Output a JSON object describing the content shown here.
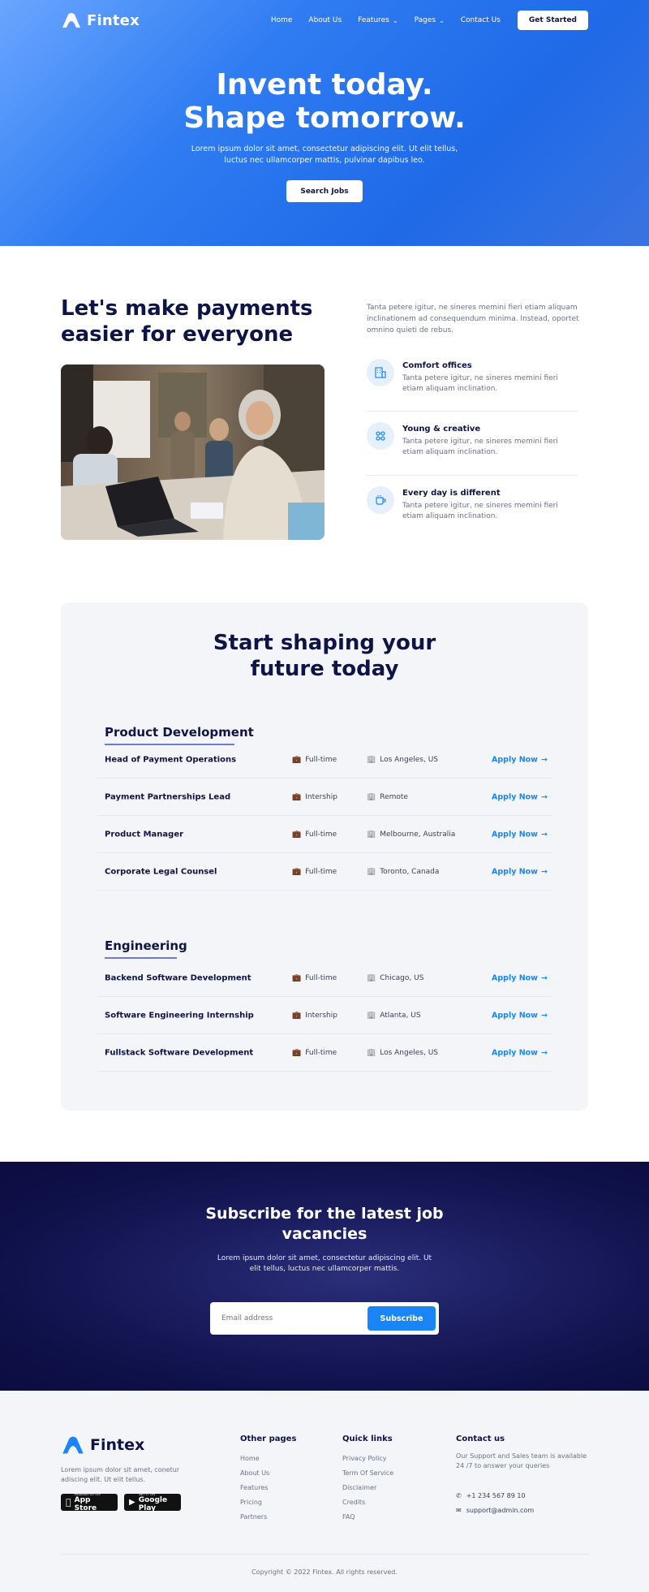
{
  "header": {
    "brand": "Fintex",
    "nav": [
      {
        "label": "Home",
        "has_dropdown": false
      },
      {
        "label": "About Us",
        "has_dropdown": false
      },
      {
        "label": "Features",
        "has_dropdown": true
      },
      {
        "label": "Pages",
        "has_dropdown": true
      },
      {
        "label": "Contact Us",
        "has_dropdown": false
      }
    ],
    "cta": "Get Started"
  },
  "hero": {
    "title_line1": "Invent today.",
    "title_line2": "Shape tomorrow.",
    "subtitle_line1": "Lorem ipsum dolor sit amet, consectetur adipiscing elit. Ut elit tellus,",
    "subtitle_line2": "luctus nec ullamcorper mattis, pulvinar dapibus leo.",
    "button": "Search Jobs"
  },
  "about": {
    "title_line1": "Let's make payments",
    "title_line2": "easier for everyone",
    "intro": "Tanta petere igitur, ne sineres memini fieri etiam aliquam inclinationem ad consequendum minima. Instead, oportet omnino quieti de rebus.",
    "features": [
      {
        "title": "Comfort offices",
        "desc": "Tanta petere igitur, ne sineres memini fieri etiam aliquam inclination.",
        "icon": "building-icon"
      },
      {
        "title": "Young & creative",
        "desc": "Tanta petere igitur, ne sineres memini fieri etiam aliquam inclination.",
        "icon": "team-icon"
      },
      {
        "title": "Every day is different",
        "desc": "Tanta petere igitur, ne sineres memini fieri etiam aliquam inclination.",
        "icon": "coffee-icon"
      }
    ]
  },
  "jobs": {
    "title_line1": "Start shaping your",
    "title_line2": "future today",
    "apply_label": "Apply Now",
    "categories": [
      {
        "name": "Product Development",
        "rows": [
          {
            "title": "Head of Payment Operations",
            "type": "Full-time",
            "location": "Los Angeles, US"
          },
          {
            "title": "Payment Partnerships Lead",
            "type": "Intership",
            "location": "Remote"
          },
          {
            "title": "Product Manager",
            "type": "Full-time",
            "location": "Melbourne, Australia"
          },
          {
            "title": "Corporate Legal Counsel",
            "type": "Full-time",
            "location": "Toronto, Canada"
          }
        ]
      },
      {
        "name": "Engineering",
        "rows": [
          {
            "title": "Backend Software Development",
            "type": "Full-time",
            "location": "Chicago, US"
          },
          {
            "title": "Software Engineering Internship",
            "type": "Intership",
            "location": "Atlanta, US"
          },
          {
            "title": "Fullstack Software Development",
            "type": "Full-time",
            "location": "Los Angeles, US"
          }
        ]
      }
    ]
  },
  "subscribe": {
    "title_line1": "Subscribe for the latest job",
    "title_line2": "vacancies",
    "text_line1": "Lorem ipsum dolor sit amet, consectetur adipiscing elit. Ut",
    "text_line2": "elit tellus, luctus nec ullamcorper mattis.",
    "placeholder": "Email address",
    "button": "Subscribe"
  },
  "footer": {
    "brand": "Fintex",
    "description": "Lorem ipsum dolor sit amet, conetur adiscing elit. Ut elit tellus.",
    "app_store": {
      "small": "Available on the",
      "big": "App Store"
    },
    "google_play": {
      "small": "GET IT ON",
      "big": "Google Play"
    },
    "other_pages": {
      "title": "Other pages",
      "links": [
        "Home",
        "About Us",
        "Features",
        "Pricing",
        "Partners"
      ]
    },
    "quick_links": {
      "title": "Quick links",
      "links": [
        "Privacy Policy",
        "Term Of Service",
        "Disclaimer",
        "Credits",
        "FAQ"
      ]
    },
    "contact": {
      "title": "Contact us",
      "description": "Our Support and Sales team is available 24 /7 to answer your queries",
      "phone": "+1 234 567 89 10",
      "email": "support@admin.com"
    },
    "copyright": "Copyright © 2022 Fintex. All rights reserved."
  },
  "colors": {
    "brand_blue": "#1a86f5",
    "navy": "#0f1446",
    "hero_gradient": "#2f7cf2",
    "subscribe_bg": "#0e1048"
  }
}
